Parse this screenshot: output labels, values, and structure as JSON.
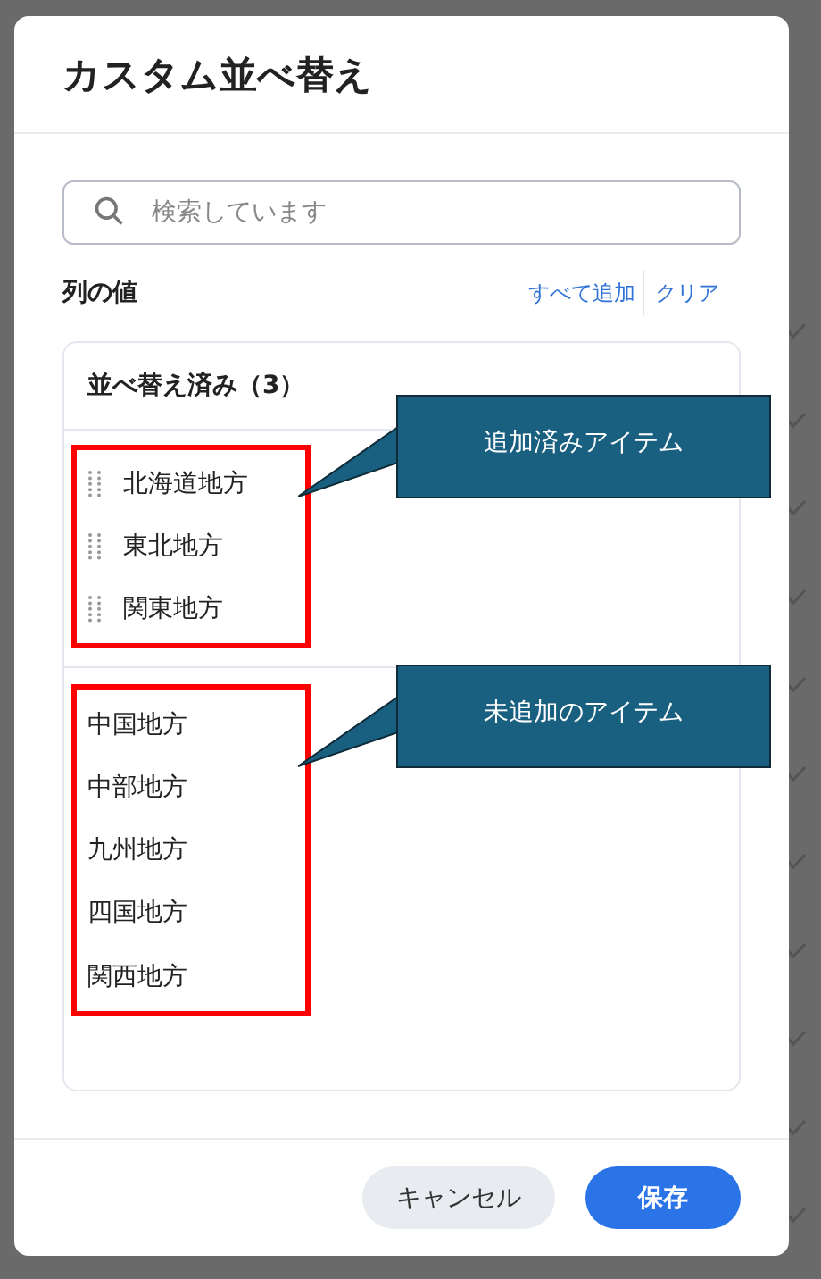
{
  "dialog": {
    "title": "カスタム並べ替え",
    "search": {
      "placeholder": "検索しています"
    },
    "column_label": "列の値",
    "actions": [
      "すべて追加",
      "クリア"
    ],
    "sorted_header": "並べ替え済み（3）",
    "sorted_items": [
      "北海道地方",
      "東北地方",
      "関東地方"
    ],
    "unsorted_items": [
      "中国地方",
      "中部地方",
      "九州地方",
      "四国地方",
      "関西地方"
    ],
    "buttons": [
      {
        "label": "キャンセル",
        "kind": "secondary"
      },
      {
        "label": "保存",
        "kind": "primary"
      }
    ]
  },
  "annotations": [
    {
      "text": "追加済みアイテム"
    },
    {
      "text": "未追加のアイテム"
    }
  ]
}
